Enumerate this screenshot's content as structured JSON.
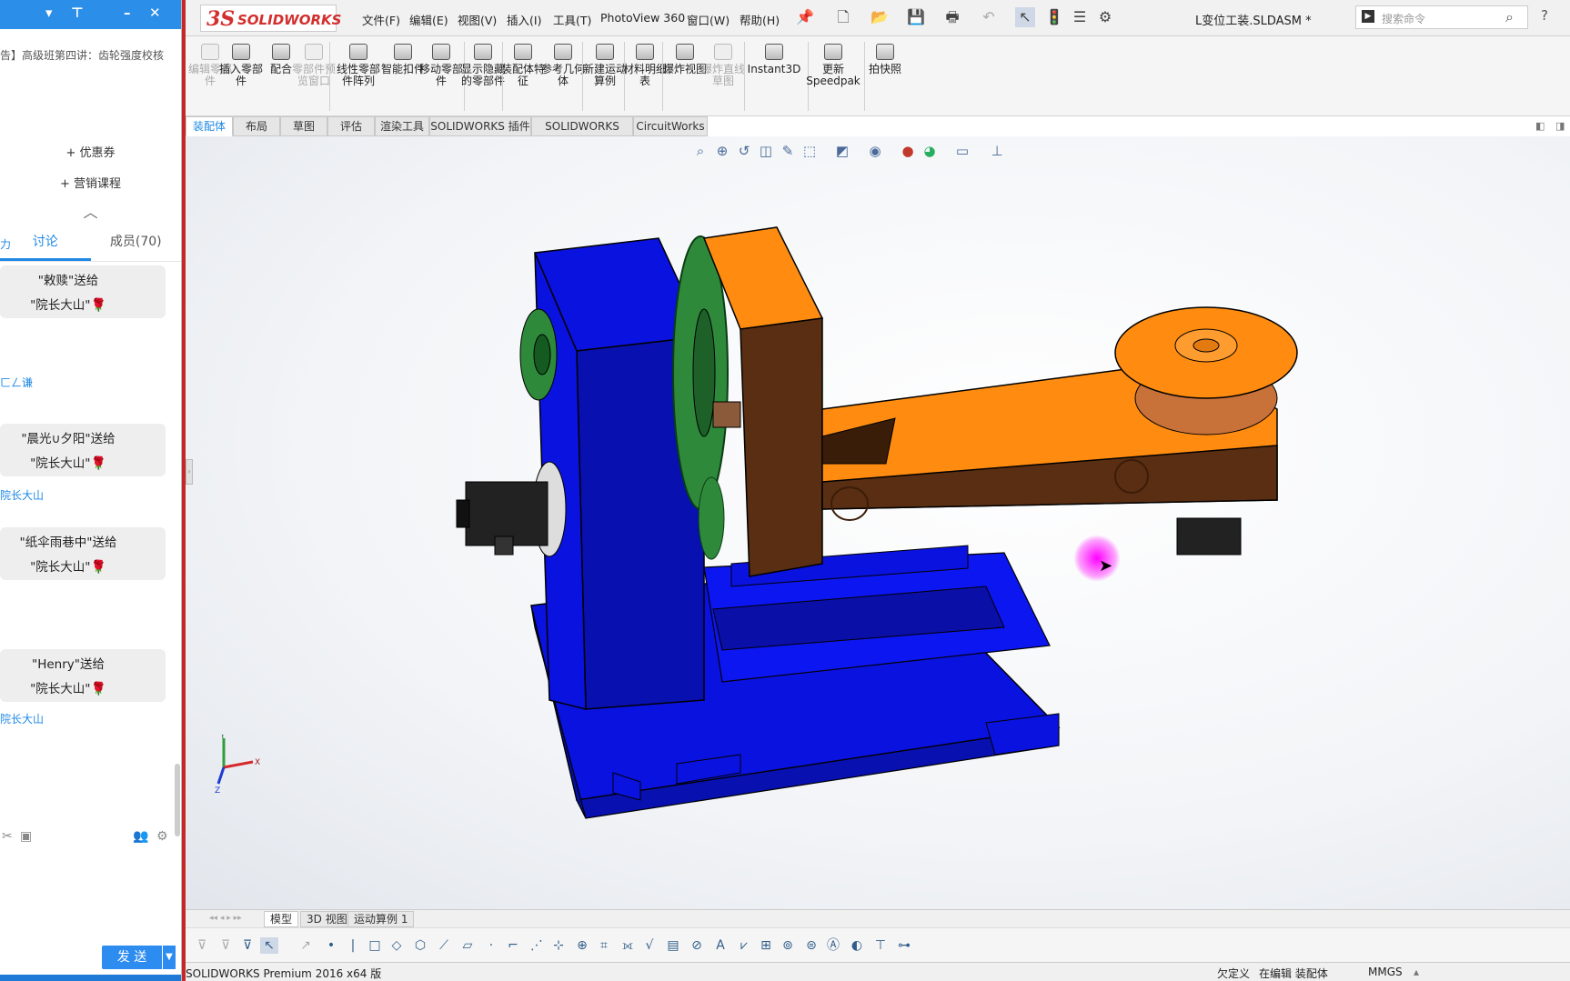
{
  "chat": {
    "header_title": "告】高级班第四讲：齿轮强度校核",
    "buttons": {
      "coupon": "+ 优惠券",
      "course": "+ 营销课程"
    },
    "collapse_icon": "chevron-up-icon",
    "tabs": {
      "discuss": "讨论",
      "members": "成员(70)"
    },
    "system_lines": [
      "力",
      "ㄈㄥ谦",
      "院长大山",
      "院长大山"
    ],
    "gifts": [
      {
        "from": "\"敕赎\"送给",
        "to": "\"院长大山\""
      },
      {
        "from": "\"晨光∪夕阳\"送给",
        "to": "\"院长大山\""
      },
      {
        "from": "\"纸伞雨巷中\"送给",
        "to": "\"院长大山\""
      },
      {
        "from": "\"Henry\"送给",
        "to": "\"院长大山\""
      }
    ],
    "send_label": "发 送",
    "colors": {
      "accent": "#1e88e5",
      "titlebar": "#2b8ee8",
      "bubble": "#eeeeee"
    }
  },
  "sw": {
    "logo_ds": "3S",
    "logo_name": "SOLIDWORKS",
    "menus": [
      "文件(F)",
      "编辑(E)",
      "视图(V)",
      "插入(I)",
      "工具(T)",
      "PhotoView 360",
      "窗口(W)",
      "帮助(H)"
    ],
    "doc_title": "L变位工装.SLDASM *",
    "search_placeholder": "搜索命令",
    "ribbon": [
      {
        "label": "编辑零部件",
        "disabled": true
      },
      {
        "label": "插入零部件",
        "disabled": false
      },
      {
        "label": "配合",
        "disabled": false
      },
      {
        "label": "零部件预览窗口",
        "disabled": true
      },
      {
        "label": "线性零部件阵列",
        "disabled": false
      },
      {
        "label": "智能扣件",
        "disabled": false
      },
      {
        "label": "移动零部件",
        "disabled": false
      },
      {
        "label": "显示隐藏的零部件",
        "disabled": false
      },
      {
        "label": "装配体特征",
        "disabled": false
      },
      {
        "label": "参考几何体",
        "disabled": false
      },
      {
        "label": "新建运动算例",
        "disabled": false
      },
      {
        "label": "材料明细表",
        "disabled": false
      },
      {
        "label": "爆炸视图",
        "disabled": false
      },
      {
        "label": "爆炸直线草图",
        "disabled": true
      },
      {
        "label": "Instant3D",
        "disabled": false
      },
      {
        "label": "更新 Speedpak",
        "disabled": false
      },
      {
        "label": "拍快照",
        "disabled": false
      }
    ],
    "command_tabs": [
      "装配体",
      "布局",
      "草图",
      "评估",
      "渲染工具",
      "SOLIDWORKS 插件",
      "SOLIDWORKS MBD",
      "CircuitWorks"
    ],
    "bottom_tabs": [
      "模型",
      "3D 视图",
      "运动算例 1"
    ],
    "status": {
      "product": "SOLIDWORKS Premium 2016 x64 版",
      "definition": "欠定义",
      "editing": "在编辑 装配体",
      "units": "MMGS"
    },
    "triad": {
      "x": "X",
      "y": "Y",
      "z": "Z"
    },
    "model_colors": {
      "base": "#0a12e0",
      "arm": "#ff8c10",
      "gear": "#2e8a3a",
      "motor": "#222222"
    }
  }
}
